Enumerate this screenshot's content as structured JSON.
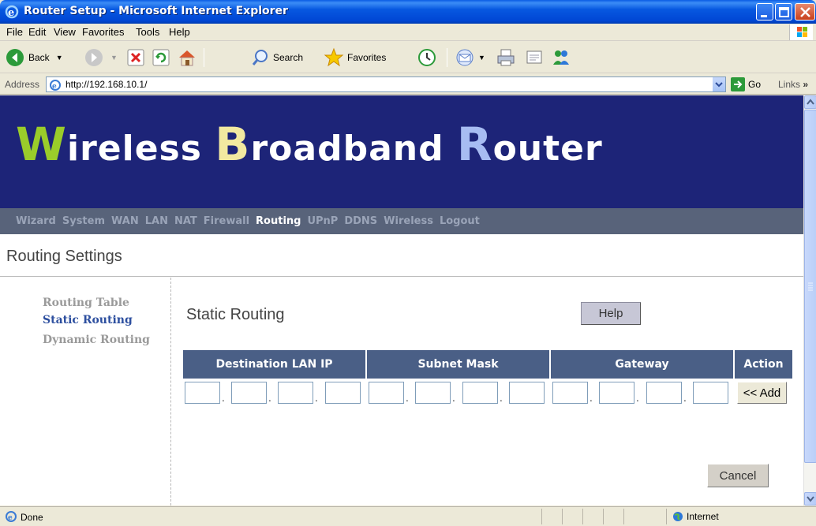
{
  "window": {
    "title": "Router Setup - Microsoft Internet Explorer"
  },
  "menu": [
    "File",
    "Edit",
    "View",
    "Favorites",
    "Tools",
    "Help"
  ],
  "toolbar": {
    "back": "Back",
    "search": "Search",
    "favorites": "Favorites"
  },
  "address": {
    "label": "Address",
    "url": "http://192.168.10.1/",
    "go": "Go",
    "links": "Links"
  },
  "banner": {
    "part1_cap": "W",
    "part1_rest": "ireless ",
    "part2_cap": "B",
    "part2_rest": "roadband ",
    "part3_cap": "R",
    "part3_rest": "outer"
  },
  "nav": [
    "Wizard",
    "System",
    "WAN",
    "LAN",
    "NAT",
    "Firewall",
    "Routing",
    "UPnP",
    "DDNS",
    "Wireless",
    "Logout"
  ],
  "nav_active": "Routing",
  "section_title": "Routing Settings",
  "sidebar": [
    {
      "label": "Routing Table",
      "active": false
    },
    {
      "label": "Static Routing",
      "active": true
    },
    {
      "label": "Dynamic Routing",
      "active": false
    }
  ],
  "content": {
    "title": "Static Routing",
    "help_label": "Help",
    "columns": [
      "Destination LAN IP",
      "Subnet Mask",
      "Gateway",
      "Action"
    ],
    "add_label": "<< Add",
    "cancel_label": "Cancel"
  },
  "status": {
    "text": "Done",
    "zone": "Internet"
  },
  "colors": {
    "banner_bg": "#1d2478",
    "nav_bg": "#58637a",
    "table_head": "#4a5f86"
  }
}
